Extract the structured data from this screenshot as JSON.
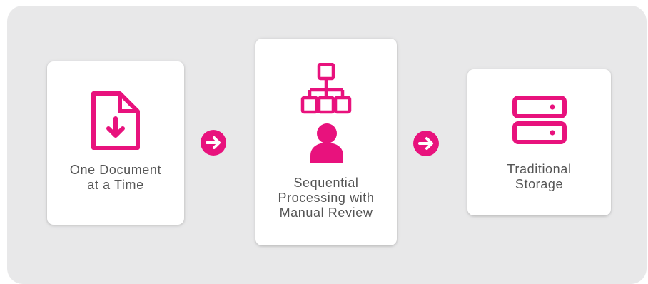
{
  "colors": {
    "accent": "#e8127d",
    "panel_background": "#e8e8e9",
    "card_background": "#ffffff",
    "label_text": "#555555"
  },
  "steps": [
    {
      "icon": "document-download-icon",
      "label": "One Document\nat a Time"
    },
    {
      "icon": "hierarchy-user-icon",
      "label": "Sequential\nProcessing with\nManual Review"
    },
    {
      "icon": "server-storage-icon",
      "label": "Traditional\nStorage"
    }
  ],
  "connectors": [
    {
      "icon": "arrow-right-circle-icon"
    },
    {
      "icon": "arrow-right-circle-icon"
    }
  ]
}
